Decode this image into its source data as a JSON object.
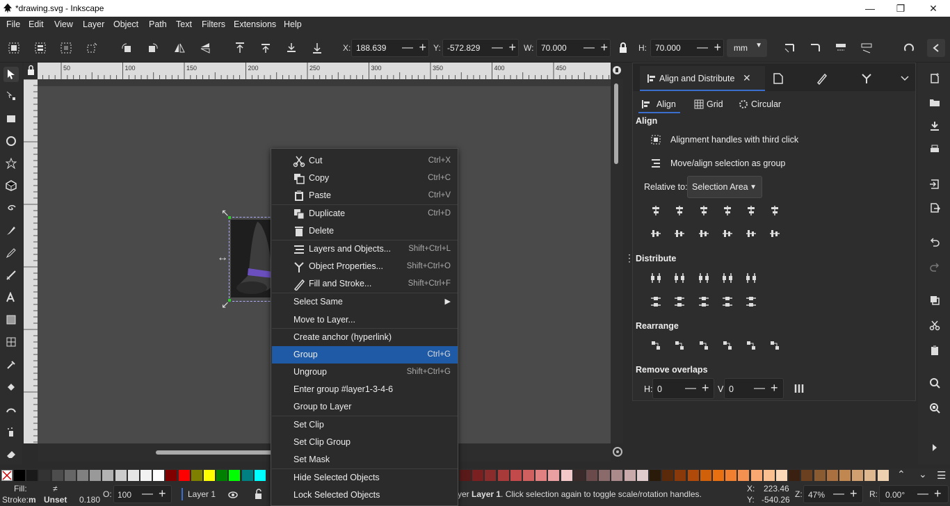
{
  "window": {
    "title": "*drawing.svg - Inkscape"
  },
  "menubar": [
    "File",
    "Edit",
    "View",
    "Layer",
    "Object",
    "Path",
    "Text",
    "Filters",
    "Extensions",
    "Help"
  ],
  "toolbar": {
    "x_label": "X:",
    "x_value": "188.639",
    "y_label": "Y:",
    "y_value": "-572.829",
    "w_label": "W:",
    "w_value": "70.000",
    "h_label": "H:",
    "h_value": "70.000",
    "unit": "mm"
  },
  "ruler": {
    "h_ticks": [
      "50",
      "100",
      "150",
      "200",
      "250",
      "300",
      "350",
      "400",
      "450"
    ]
  },
  "dock": {
    "tab_title": "Align and Distribute",
    "subtabs": [
      "Align",
      "Grid",
      "Circular"
    ],
    "align_heading": "Align",
    "opt_third_click": "Alignment handles with third click",
    "opt_as_group": "Move/align selection as group",
    "relative_label": "Relative to:",
    "relative_value": "Selection Area",
    "distribute_heading": "Distribute",
    "rearrange_heading": "Rearrange",
    "overlap_heading": "Remove overlaps",
    "overlap_h_label": "H:",
    "overlap_h_value": "0",
    "overlap_v_label": "V:",
    "overlap_v_value": "0"
  },
  "context_menu": {
    "items": [
      {
        "label": "Cut",
        "shortcut": "Ctrl+X"
      },
      {
        "label": "Copy",
        "shortcut": "Ctrl+C"
      },
      {
        "label": "Paste",
        "shortcut": "Ctrl+V"
      },
      {
        "label": "Duplicate",
        "shortcut": "Ctrl+D"
      },
      {
        "label": "Delete",
        "shortcut": ""
      },
      {
        "label": "Layers and Objects...",
        "shortcut": "Shift+Ctrl+L"
      },
      {
        "label": "Object Properties...",
        "shortcut": "Shift+Ctrl+O"
      },
      {
        "label": "Fill and Stroke...",
        "shortcut": "Shift+Ctrl+F"
      },
      {
        "label": "Select Same",
        "shortcut": ""
      },
      {
        "label": "Move to Layer...",
        "shortcut": ""
      },
      {
        "label": "Create anchor (hyperlink)",
        "shortcut": ""
      },
      {
        "label": "Group",
        "shortcut": "Ctrl+G"
      },
      {
        "label": "Ungroup",
        "shortcut": "Shift+Ctrl+G"
      },
      {
        "label": "Enter group #layer1-3-4-6",
        "shortcut": ""
      },
      {
        "label": "Group to Layer",
        "shortcut": ""
      },
      {
        "label": "Set Clip",
        "shortcut": ""
      },
      {
        "label": "Set Clip Group",
        "shortcut": ""
      },
      {
        "label": "Set Mask",
        "shortcut": ""
      },
      {
        "label": "Hide Selected Objects",
        "shortcut": ""
      },
      {
        "label": "Lock Selected Objects",
        "shortcut": ""
      }
    ]
  },
  "status": {
    "fill_label": "Fill:",
    "fill_value": "≠",
    "stroke_label": "Stroke:",
    "stroke_value": "m",
    "stroke_unset": "Unset",
    "stroke_width": "0.180",
    "opacity_label": "O:",
    "opacity_value": "100",
    "layer": "Layer 1",
    "message_prefix": "yer ",
    "message_bold": "Layer 1",
    "message_rest": ". Click selection again to toggle scale/rotation handles.",
    "cursor_x_label": "X:",
    "cursor_x": "223.46",
    "cursor_y_label": "Y:",
    "cursor_y": "-540.26",
    "zoom_label": "Z:",
    "zoom": "47%",
    "rotate_label": "R:",
    "rotate": "0.00°"
  },
  "palette_colors": [
    "#000000",
    "#1a1a1a",
    "#333333",
    "#4d4d4d",
    "#666666",
    "#808080",
    "#999999",
    "#b3b3b3",
    "#cccccc",
    "#e6e6e6",
    "#f2f2f2",
    "#ffffff",
    "#800000",
    "#ff0000",
    "#808000",
    "#ffff00",
    "#008000",
    "#00ff00",
    "#008080",
    "#00ffff"
  ],
  "palette_colors_right": [
    "#5a1a1a",
    "#7a2020",
    "#8b2c2c",
    "#a83a3a",
    "#c24a4a",
    "#d06060",
    "#e08080",
    "#eaa0a0",
    "#f4c8c8",
    "#3a2a2a",
    "#6a4a4a",
    "#8a6a6a",
    "#aa8a8a",
    "#c8aaaa",
    "#e0cccc",
    "#2a1a0a",
    "#5a2a0a",
    "#8a3a0a",
    "#b04a0a",
    "#d0600a",
    "#e87010",
    "#f08030",
    "#f49050",
    "#f8a870",
    "#fcc090",
    "#fcd8b8",
    "#3a2010",
    "#6a4020",
    "#8a5a30",
    "#aa7040",
    "#c08850",
    "#d0a070",
    "#e0b890",
    "#ecd0b0"
  ]
}
